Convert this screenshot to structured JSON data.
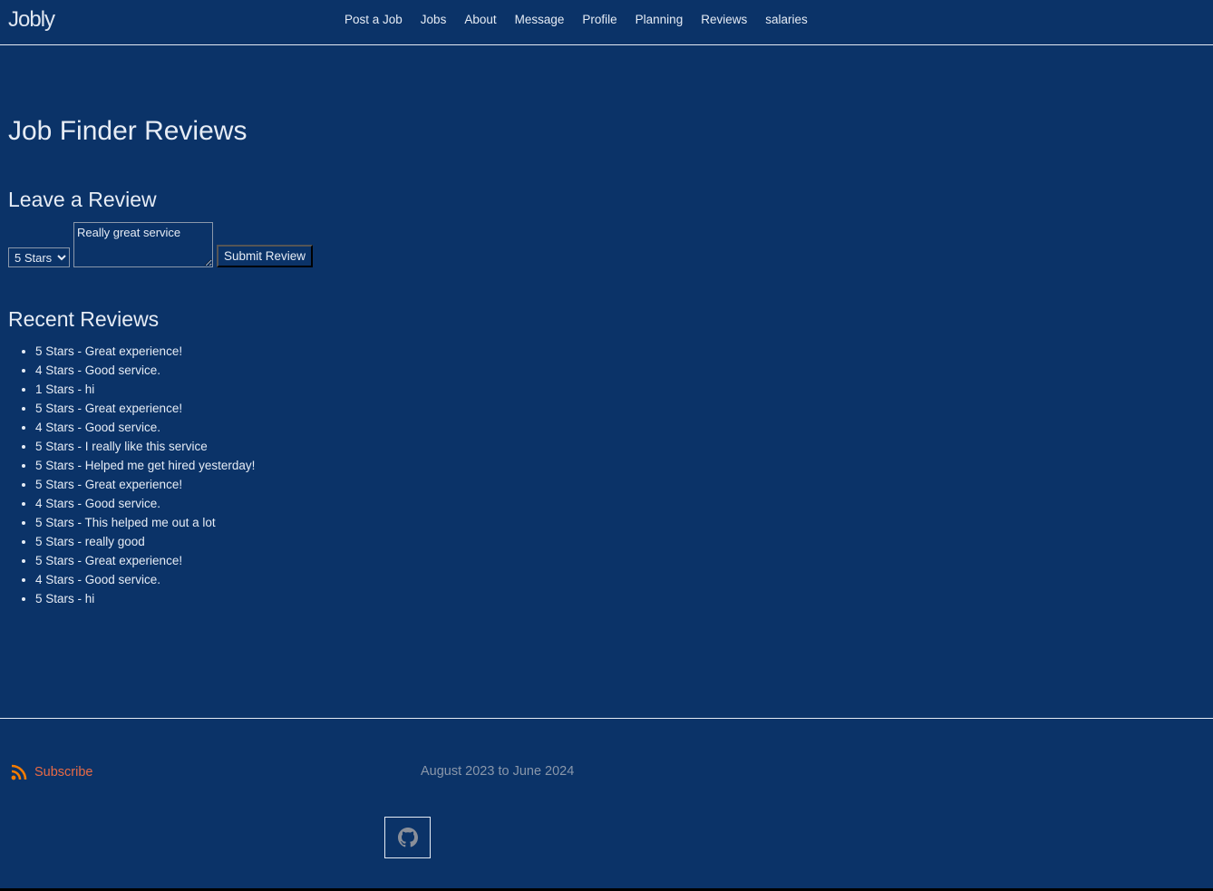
{
  "nav": {
    "logo": "Jobly",
    "links": [
      "Post a Job",
      "Jobs",
      "About",
      "Message",
      "Profile",
      "Planning",
      "Reviews",
      "salaries"
    ]
  },
  "page": {
    "title": "Job Finder Reviews"
  },
  "form": {
    "heading": "Leave a Review",
    "rating_selected": "5 Stars",
    "review_text": "Really great service",
    "submit_label": "Submit Review"
  },
  "recent": {
    "heading": "Recent Reviews",
    "items": [
      "5 Stars - Great experience!",
      "4 Stars - Good service.",
      "1 Stars - hi",
      "5 Stars - Great experience!",
      "4 Stars - Good service.",
      "5 Stars - I really like this service",
      "5 Stars - Helped me get hired yesterday!",
      "5 Stars - Great experience!",
      "4 Stars - Good service.",
      "5 Stars - This helped me out a lot",
      "5 Stars - really good",
      "5 Stars - Great experience!",
      "4 Stars - Good service.",
      "5 Stars - hi"
    ]
  },
  "footer": {
    "subscribe_label": "Subscribe",
    "date_range": "August 2023 to June 2024",
    "icons": {
      "rss": "rss-icon",
      "github": "github-icon"
    },
    "colors": {
      "subscribe": "#e86a45",
      "rss": "#f57c00"
    }
  }
}
